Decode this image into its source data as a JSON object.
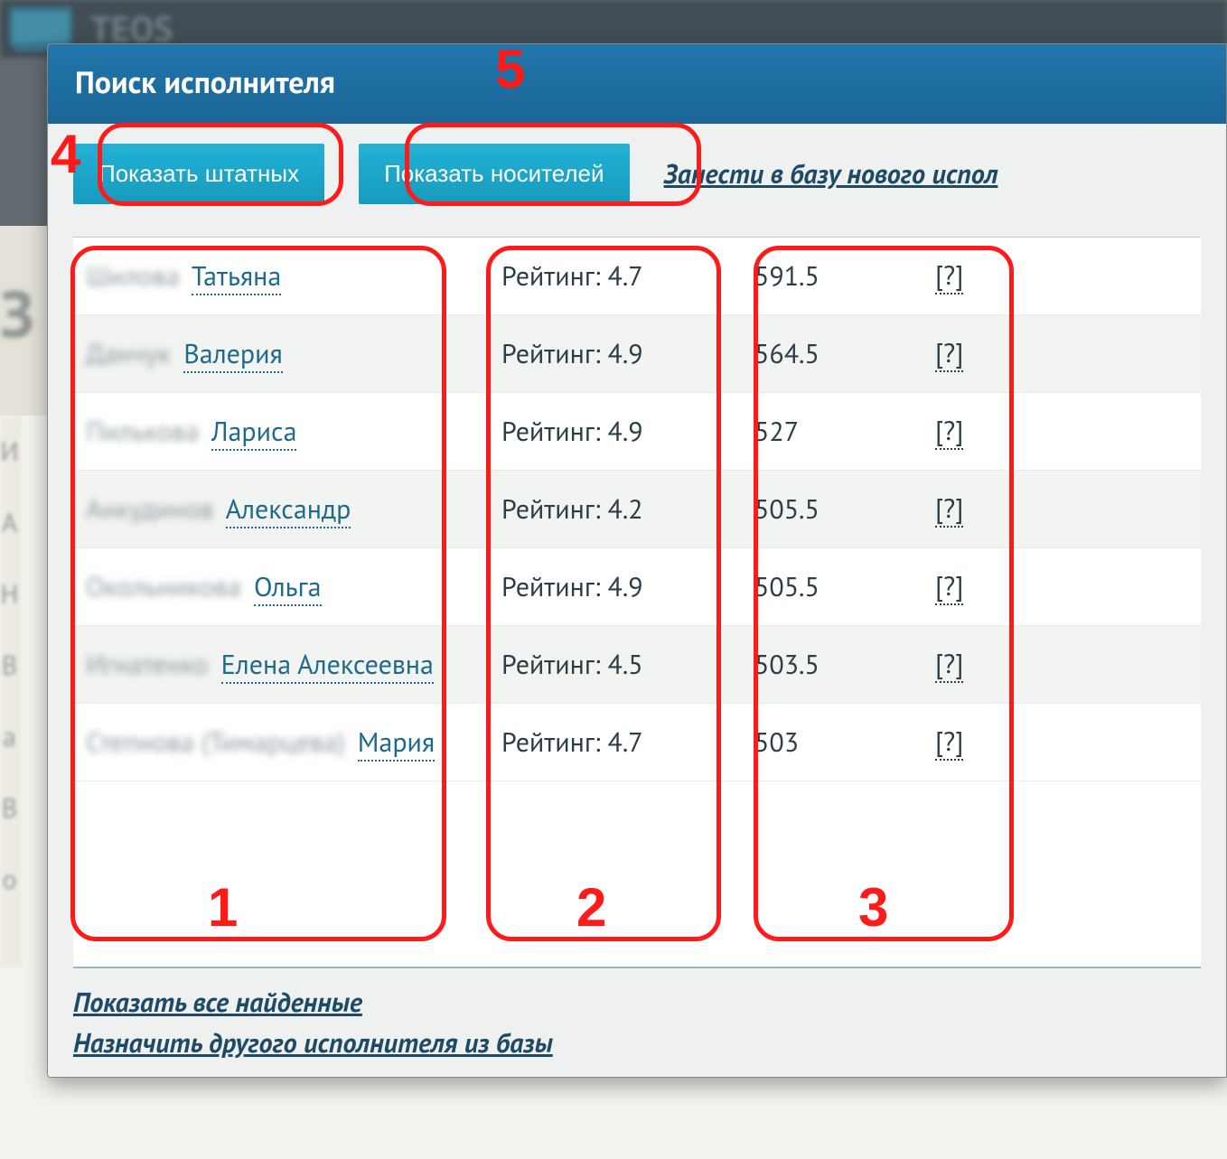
{
  "app": {
    "name_hint": "TEOS"
  },
  "modal": {
    "title": "Поиск исполнителя",
    "buttons": {
      "show_staff": "Показать штатных",
      "show_native": "Показать носителей"
    },
    "links": {
      "add_new": "Занести в базу нового испол",
      "show_all": "Показать все найденные",
      "assign_other": "Назначить другого исполнителя из базы"
    },
    "rating_label": "Рейтинг:",
    "help_mark": "[?]",
    "results": [
      {
        "surname_masked": "Шилова",
        "given": "Татьяна",
        "rating": "4.7",
        "score": "591.5"
      },
      {
        "surname_masked": "Данчук",
        "given": "Валерия",
        "rating": "4.9",
        "score": "564.5"
      },
      {
        "surname_masked": "Пилькова",
        "given": "Лариса",
        "rating": "4.9",
        "score": "527"
      },
      {
        "surname_masked": "Анкудинов",
        "given": "Александр",
        "rating": "4.2",
        "score": "505.5"
      },
      {
        "surname_masked": "Окольникова",
        "given": "Ольга",
        "rating": "4.9",
        "score": "505.5"
      },
      {
        "surname_masked": "Игнатенко",
        "given": "Елена Алексеевна",
        "rating": "4.5",
        "score": "503.5"
      },
      {
        "surname_masked": "Степнова (Тимарцева)",
        "given": "Мария",
        "rating": "4.7",
        "score": "503"
      }
    ]
  },
  "annotations": {
    "1": "1",
    "2": "2",
    "3": "3",
    "4": "4",
    "5": "5"
  }
}
